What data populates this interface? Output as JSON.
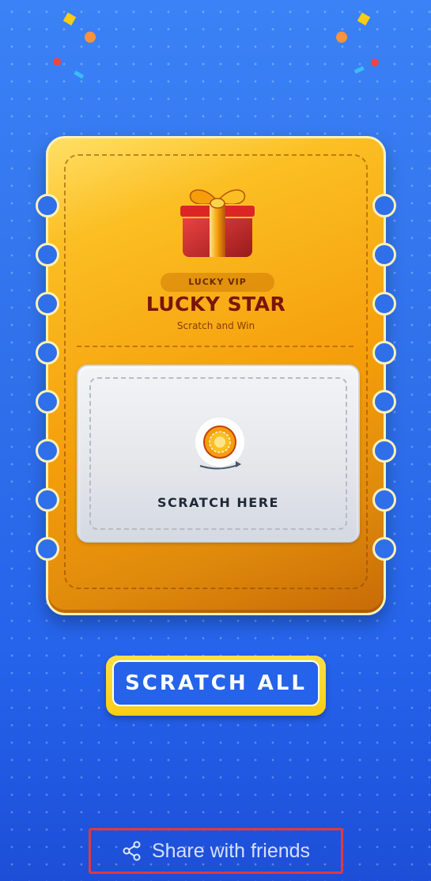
{
  "colors": {
    "background": "#2f6fea",
    "card_gold": "#f59e0b",
    "title_red": "#7a1508",
    "button_yellow": "#facc15",
    "button_blue": "#2563eb",
    "highlight_red": "#e0393e"
  },
  "card": {
    "badge": "LUCKY VIP",
    "title": "LUCKY STAR",
    "subtitle": "Scratch and Win",
    "gift_icon": "gift-icon",
    "scratch_area": {
      "label": "SCRATCH HERE",
      "icon": "coin-scratch-icon"
    }
  },
  "actions": {
    "scratch_all_label": "SCRATCH ALL",
    "share_label": "Share with friends",
    "share_icon": "share-icon"
  }
}
